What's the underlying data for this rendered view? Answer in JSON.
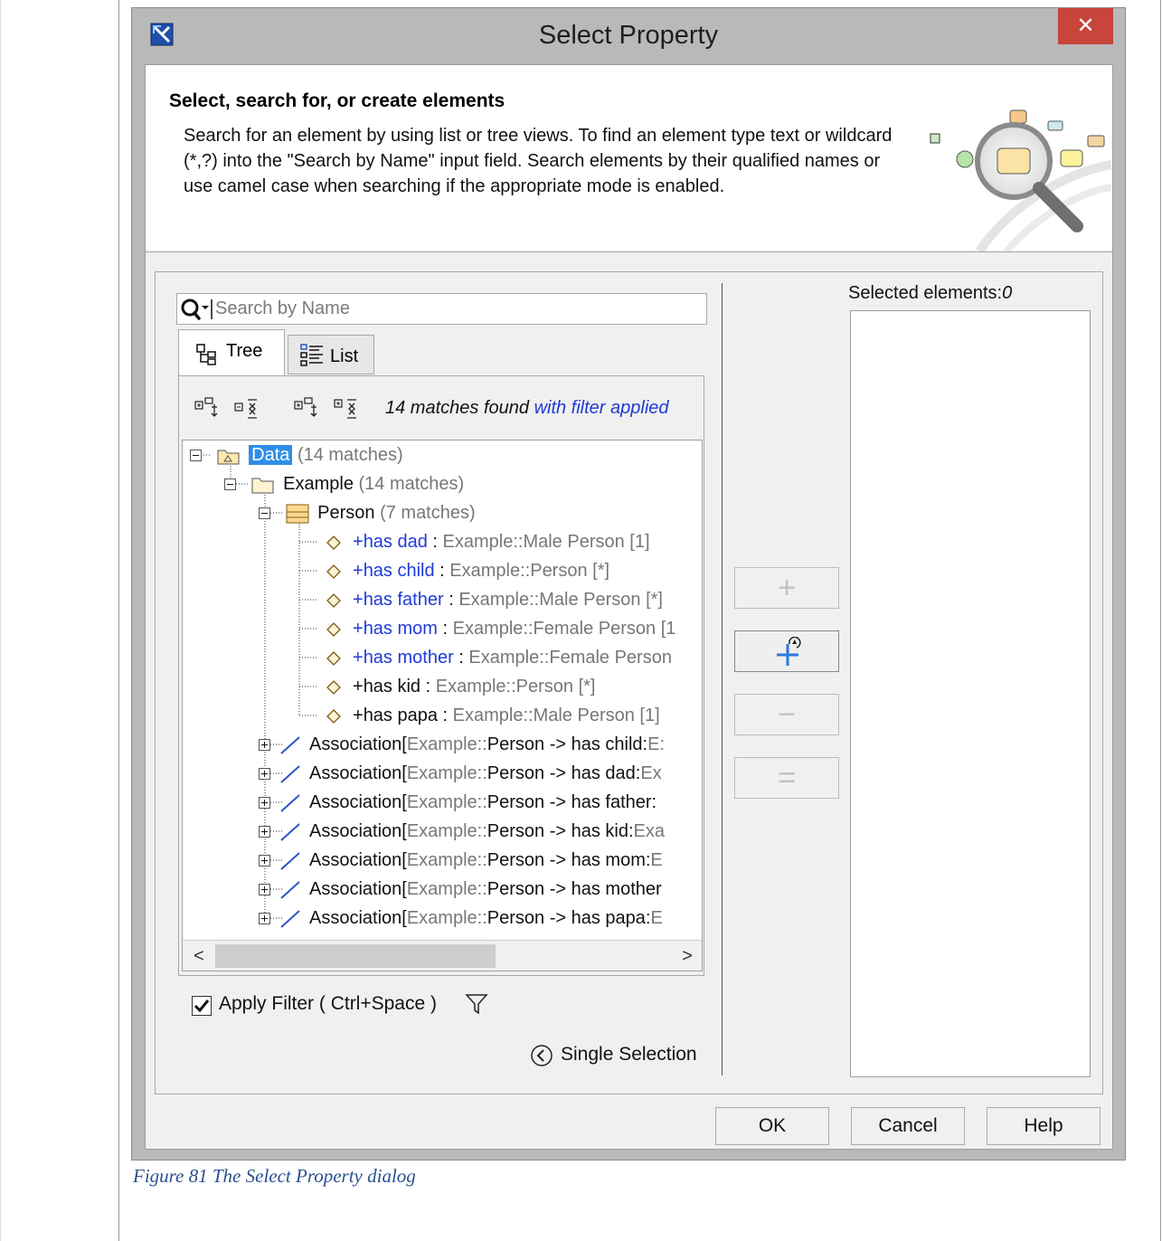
{
  "dialog": {
    "title": "Select Property",
    "close_label": "✕"
  },
  "header": {
    "title": "Select, search for, or create elements",
    "description": "Search for an element by using list or tree views. To find an element type text or wildcard (*,?) into the \"Search by Name\" input field. Search elements by their qualified names or use camel case when searching if the appropriate mode is enabled."
  },
  "search": {
    "placeholder": "Search by Name",
    "value": ""
  },
  "tabs": [
    {
      "label": "Tree",
      "active": true
    },
    {
      "label": "List",
      "active": false
    }
  ],
  "toolbar": {
    "matches_text": "14 matches found",
    "filter_text": "with filter applied"
  },
  "tree": {
    "root": {
      "name": "Data",
      "count": "(14 matches)"
    },
    "package": {
      "name": "Example",
      "count": "(14 matches)"
    },
    "class": {
      "name": "Person",
      "count": "(7 matches)"
    },
    "properties": [
      {
        "prefix": "+",
        "name": "has dad",
        "sep": " : ",
        "type": "Example::Male Person [1]",
        "highlight": true
      },
      {
        "prefix": "+",
        "name": "has child",
        "sep": " : ",
        "type": "Example::Person [*]",
        "highlight": true
      },
      {
        "prefix": "+",
        "name": "has father",
        "sep": " : ",
        "type": "Example::Male Person [*]",
        "highlight": true
      },
      {
        "prefix": "+",
        "name": "has mom",
        "sep": " : ",
        "type": "Example::Female Person [1",
        "highlight": true
      },
      {
        "prefix": "+",
        "name": "has mother",
        "sep": " : ",
        "type": "Example::Female Person",
        "highlight": true
      },
      {
        "prefix": "+",
        "name": "has kid",
        "sep": " : ",
        "type": "Example::Person [*]",
        "highlight": false
      },
      {
        "prefix": "+",
        "name": "has papa",
        "sep": " : ",
        "type": "Example::Male Person [1]",
        "highlight": false
      }
    ],
    "associations": [
      {
        "label": "Association[",
        "owner": "Example::",
        "rest": "Person -> has child:",
        "tail": "E:"
      },
      {
        "label": "Association[",
        "owner": "Example::",
        "rest": "Person -> has dad:",
        "tail": "Ex"
      },
      {
        "label": "Association[",
        "owner": "Example::",
        "rest": "Person -> has father:",
        "tail": ""
      },
      {
        "label": "Association[",
        "owner": "Example::",
        "rest": "Person -> has kid:",
        "tail": "Exa"
      },
      {
        "label": "Association[",
        "owner": "Example::",
        "rest": "Person -> has mom:",
        "tail": "E"
      },
      {
        "label": "Association[",
        "owner": "Example::",
        "rest": "Person -> has mother",
        "tail": ""
      },
      {
        "label": "Association[",
        "owner": "Example::",
        "rest": "Person -> has papa:",
        "tail": "E"
      }
    ]
  },
  "scroll": {
    "left_arrow": "<",
    "right_arrow": ">"
  },
  "filter": {
    "label": "Apply Filter ( Ctrl+Space )",
    "checked": true
  },
  "selection_mode": {
    "label": "Single Selection"
  },
  "selected": {
    "label": "Selected elements:",
    "count": "0"
  },
  "side_buttons": {
    "add": "+",
    "add_recursive": "+",
    "remove": "−",
    "remove_all": "="
  },
  "footer": {
    "ok": "OK",
    "cancel": "Cancel",
    "help": "Help"
  },
  "caption": "Figure 81   The Select Property dialog",
  "colors": {
    "accent_blue": "#1f3bd6",
    "selection": "#2f8ee6",
    "close_red": "#c7453a",
    "caption": "#2a4f8e"
  }
}
